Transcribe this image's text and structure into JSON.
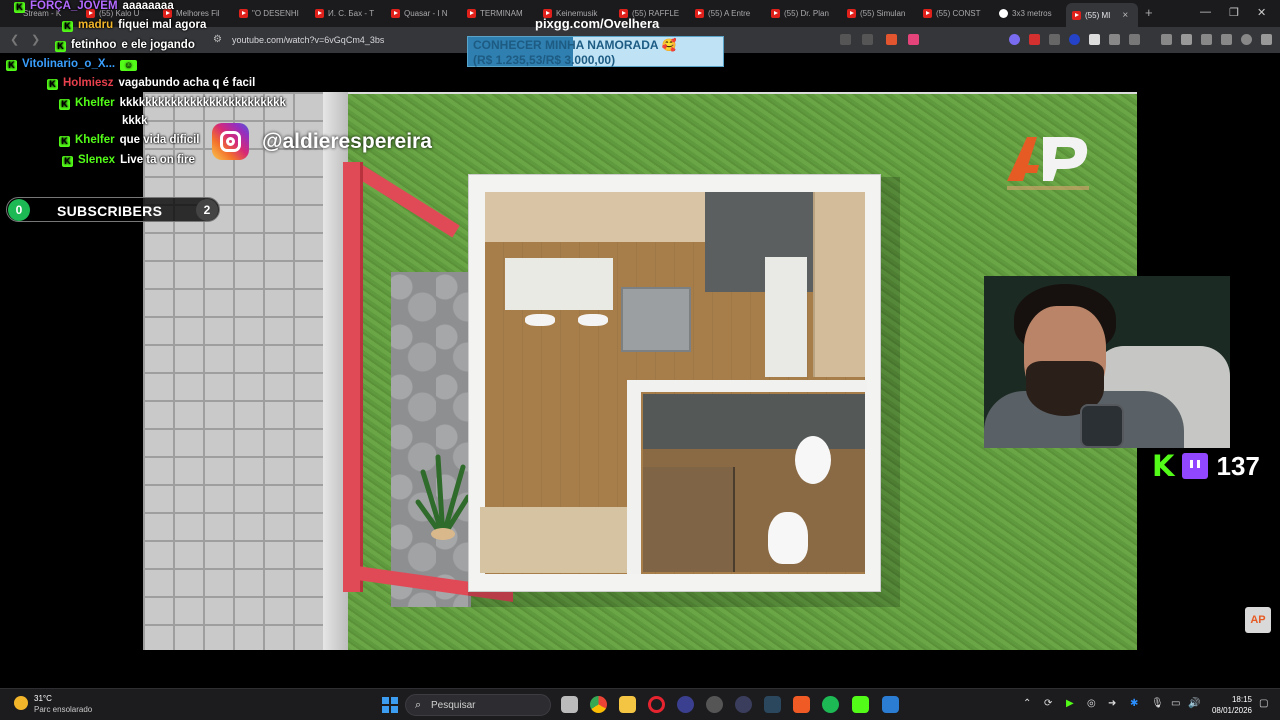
{
  "browser": {
    "tabs": [
      {
        "label": "Stream - K",
        "icon": "kick-icon"
      },
      {
        "label": "(55) Kalo U",
        "icon": "youtube-icon"
      },
      {
        "label": "Melhores Fil",
        "icon": "youtube-icon"
      },
      {
        "label": "\"O DESENHI",
        "icon": "youtube-icon"
      },
      {
        "label": "И. С. Бах - Т",
        "icon": "youtube-icon"
      },
      {
        "label": "Quasar - I N",
        "icon": "youtube-icon"
      },
      {
        "label": "TERMINAM",
        "icon": "youtube-icon"
      },
      {
        "label": "Keinemusik",
        "icon": "youtube-icon"
      },
      {
        "label": "(55) RAFFLE",
        "icon": "youtube-icon"
      },
      {
        "label": "(55) A Entre",
        "icon": "youtube-icon"
      },
      {
        "label": "(55) Dr. Plan",
        "icon": "youtube-icon"
      },
      {
        "label": "(55) Simulan",
        "icon": "youtube-icon"
      },
      {
        "label": "(55) CONST",
        "icon": "youtube-icon"
      },
      {
        "label": "3x3 metros",
        "icon": "google-icon"
      },
      {
        "label": "(55) MI",
        "icon": "youtube-icon"
      }
    ],
    "url": "youtube.com/watch?v=6vGqCm4_3bs"
  },
  "chat": [
    {
      "user": "FORÇA_JOVEM",
      "text": "aaaaaaaa",
      "color": "#b36bff"
    },
    {
      "user": "madru",
      "text": "fiquei mal agora",
      "color": "#f0b429"
    },
    {
      "user": "fetinhoo",
      "text": "e ele jogando",
      "color": "#ffffff"
    },
    {
      "user": "Vitolinario_o_X...",
      "text": "",
      "color": "#3aa0ff"
    },
    {
      "user": "Holmiesz",
      "text": "vagabundo acha q é facil",
      "color": "#e8404c"
    },
    {
      "user": "Khelfer",
      "text": "kkkkkkkkkkkkkkkkkkkkkkkkkk",
      "color": "#53fc18"
    },
    {
      "user": "",
      "text": "kkkk",
      "color": "#ffffff"
    },
    {
      "user": "Khelfer",
      "text": "que vida dificil",
      "color": "#53fc18"
    },
    {
      "user": "Slenex",
      "text": "Live ta on fire",
      "color": "#53fc18"
    }
  ],
  "subscribers": {
    "label": "SUBSCRIBERS",
    "left_count": "0",
    "right_count": "2"
  },
  "instagram": {
    "handle": "@aldierespereira"
  },
  "pix": {
    "title": "pixgg.com/Ovelhera",
    "goal_line1": "CONHECER MINHA NAMORADA 🥰",
    "goal_line2": "(R$ 1.235,53/R$ 3.000,00)",
    "progress": 0.41
  },
  "viewers": {
    "count": "137"
  },
  "taskbar": {
    "temperature": "31°C",
    "weather": "Parc ensolarado",
    "search_placeholder": "Pesquisar",
    "time": "18:15",
    "date": "08/01/2026"
  },
  "colors": {
    "kick_green": "#53fc18",
    "twitch_purple": "#9146ff",
    "youtube_red": "#e0211b"
  }
}
